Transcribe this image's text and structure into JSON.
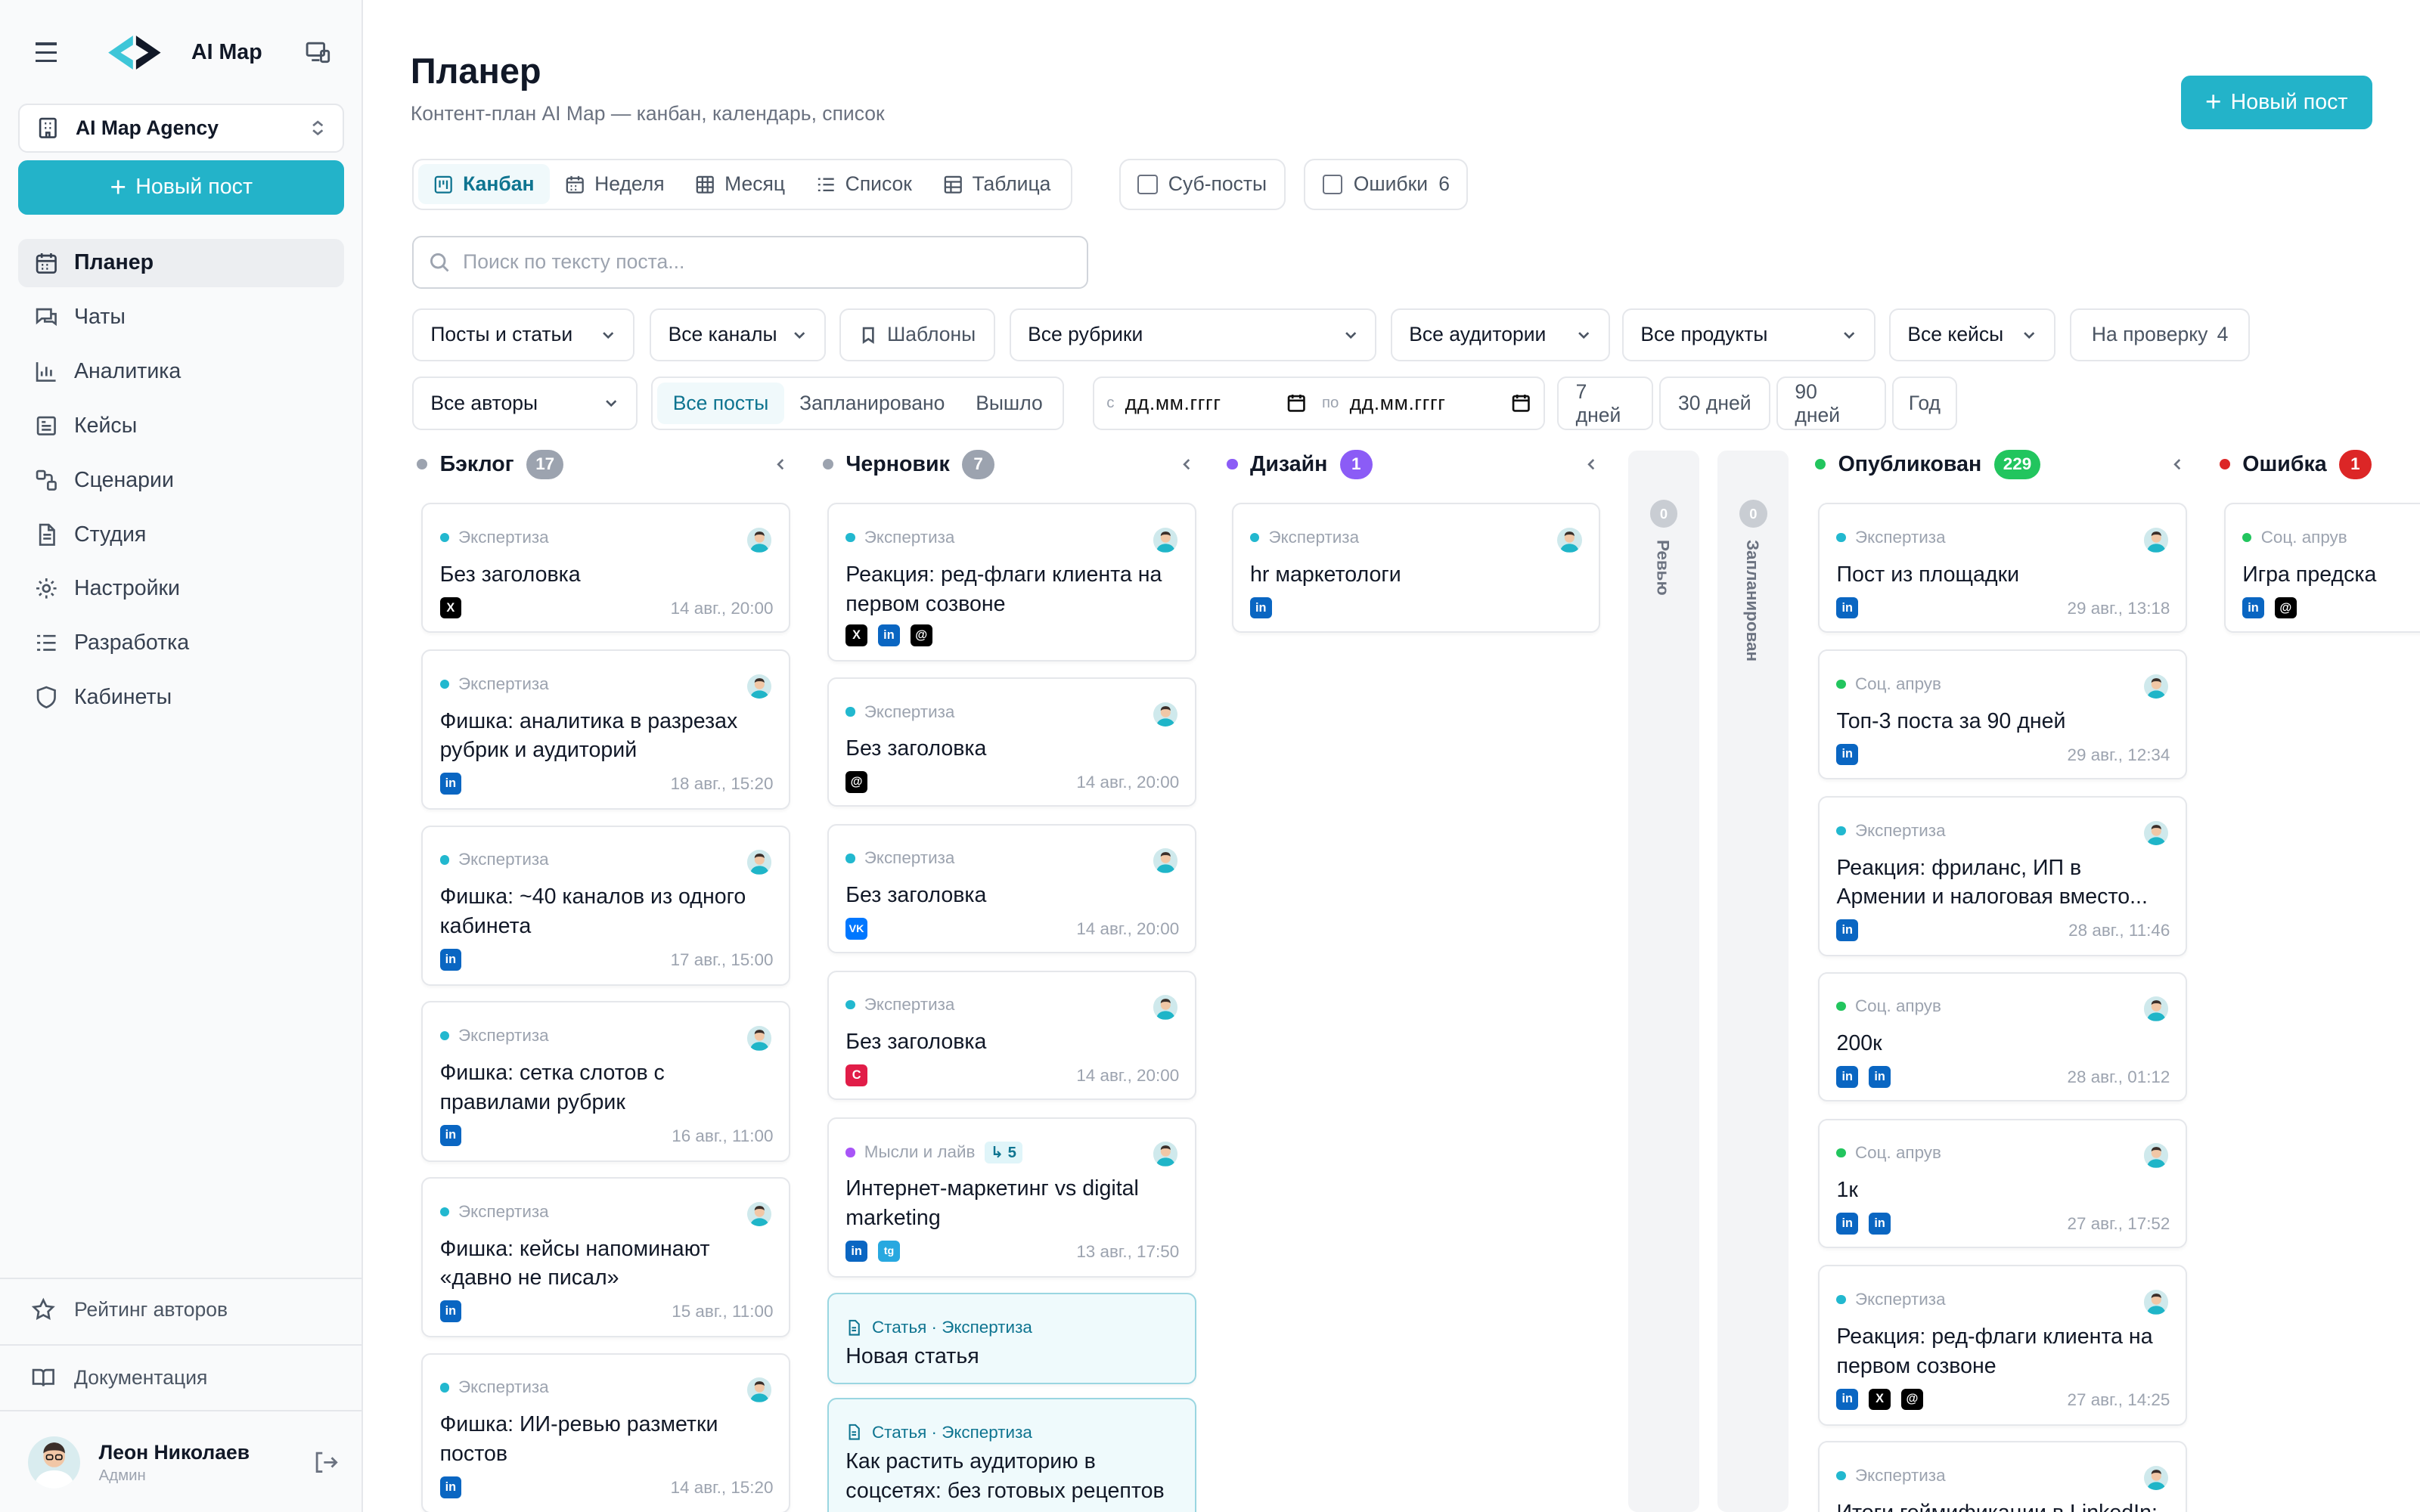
{
  "sidebar": {
    "brand": "AI Map",
    "org": "AI Map Agency",
    "new_post": "Новый пост",
    "nav": [
      {
        "label": "Планер",
        "icon": "calendar-icon",
        "active": true
      },
      {
        "label": "Чаты",
        "icon": "chat-icon"
      },
      {
        "label": "Аналитика",
        "icon": "bar-chart-icon"
      },
      {
        "label": "Кейсы",
        "icon": "cases-icon"
      },
      {
        "label": "Сценарии",
        "icon": "workflow-icon"
      },
      {
        "label": "Студия",
        "icon": "document-icon"
      },
      {
        "label": "Настройки",
        "icon": "gear-icon"
      },
      {
        "label": "Разработка",
        "icon": "list-icon"
      },
      {
        "label": "Кабинеты",
        "icon": "shield-icon"
      }
    ],
    "rating": "Рейтинг авторов",
    "docs": "Документация",
    "user": {
      "name": "Леон Николаев",
      "role": "Админ"
    }
  },
  "header": {
    "title": "Планер",
    "subtitle": "Контент-план AI Map — канбан, календарь, список",
    "new_post": "Новый пост"
  },
  "views": [
    "Канбан",
    "Неделя",
    "Месяц",
    "Список",
    "Таблица"
  ],
  "toggles": {
    "subposts": "Суб-посты",
    "errors": "Ошибки",
    "errors_count": "6"
  },
  "search": {
    "placeholder": "Поиск по тексту поста..."
  },
  "filters": {
    "type": "Посты и статьи",
    "channels": "Все каналы",
    "templates": "Шаблоны",
    "rubrics": "Все рубрики",
    "audiences": "Все аудитории",
    "products": "Все продукты",
    "cases": "Все кейсы",
    "review": "На проверку",
    "review_count": "4",
    "authors": "Все авторы",
    "status_tabs": [
      "Все посты",
      "Запланировано",
      "Вышло"
    ],
    "date_from_label": "с",
    "date_to_label": "по",
    "date_placeholder": "дд.мм.гггг",
    "ranges": [
      "7 дней",
      "30 дней",
      "90 дней",
      "Год"
    ]
  },
  "columns": [
    {
      "name": "Бэклог",
      "count": "17",
      "color": "#9ca3af"
    },
    {
      "name": "Черновик",
      "count": "7",
      "color": "#9ca3af"
    },
    {
      "name": "Дизайн",
      "count": "1",
      "color": "#8b5cf6"
    },
    {
      "name": "Ревью",
      "count": "0"
    },
    {
      "name": "Запланирован",
      "count": "0"
    },
    {
      "name": "Опубликован",
      "count": "229",
      "color": "#22c55e"
    },
    {
      "name": "Ошибка",
      "count": "1",
      "color": "#dc2626"
    }
  ],
  "cards": {
    "backlog": [
      {
        "tag": "Экспертиза",
        "title": "Без заголовка",
        "channels": [
          "x"
        ],
        "time": "14 авг., 20:00"
      },
      {
        "tag": "Экспертиза",
        "title": "Фишка: аналитика в разрезах рубрик и аудиторий",
        "channels": [
          "in"
        ],
        "time": "18 авг., 15:20"
      },
      {
        "tag": "Экспертиза",
        "title": "Фишка: ~40 каналов из одного кабинета",
        "channels": [
          "in"
        ],
        "time": "17 авг., 15:00"
      },
      {
        "tag": "Экспертиза",
        "title": "Фишка: сетка слотов с правилами рубрик",
        "channels": [
          "in"
        ],
        "time": "16 авг., 11:00"
      },
      {
        "tag": "Экспертиза",
        "title": "Фишка: кейсы напоминают «давно не писал»",
        "channels": [
          "in"
        ],
        "time": "15 авг., 11:00"
      },
      {
        "tag": "Экспертиза",
        "title": "Фишка: ИИ-ревью разметки постов",
        "channels": [
          "in"
        ],
        "time": "14 авг., 15:20"
      }
    ],
    "draft": [
      {
        "tag": "Экспертиза",
        "title": "Реакция: ред-флаги клиента на первом созвоне",
        "channels": [
          "x",
          "in",
          "@"
        ],
        "time": ""
      },
      {
        "tag": "Экспертиза",
        "title": "Без заголовка",
        "channels": [
          "@"
        ],
        "time": "14 авг., 20:00"
      },
      {
        "tag": "Экспертиза",
        "title": "Без заголовка",
        "channels": [
          "VK"
        ],
        "time": "14 авг., 20:00"
      },
      {
        "tag": "Экспертиза",
        "title": "Без заголовка",
        "channels": [
          "C"
        ],
        "time": "14 авг., 20:00"
      },
      {
        "tag": "Мысли и лайв",
        "sub": "↳ 5",
        "title": "Интернет-маркетинг vs digital marketing",
        "channels": [
          "in",
          "tg"
        ],
        "time": "13 авг., 17:50"
      },
      {
        "tag": "Статья · Экспертиза",
        "title": "Новая статья"
      },
      {
        "tag": "Статья · Экспертиза",
        "title": "Как растить аудиторию в соцсетях: без готовых рецептов"
      }
    ],
    "design": [
      {
        "tag": "Экспертиза",
        "title": "hr маркетологи",
        "channels": [
          "in"
        ]
      }
    ],
    "published": [
      {
        "tag": "Экспертиза",
        "title": "Пост из площадки",
        "channels": [
          "in"
        ],
        "time": "29 авг., 13:18"
      },
      {
        "tag": "Соц. апрув",
        "title": "Топ-3 поста за 90 дней",
        "channels": [
          "in"
        ],
        "time": "29 авг., 12:34"
      },
      {
        "tag": "Экспертиза",
        "title": "Реакция: фриланс, ИП в Армении и налоговая вместо...",
        "channels": [
          "in"
        ],
        "time": "28 авг., 11:46"
      },
      {
        "tag": "Соц. апрув",
        "title": "200к",
        "channels": [
          "in",
          "in"
        ],
        "time": "28 авг., 01:12"
      },
      {
        "tag": "Соц. апрув",
        "title": "1к",
        "channels": [
          "in",
          "in"
        ],
        "time": "27 авг., 17:52"
      },
      {
        "tag": "Экспертиза",
        "title": "Реакция: ред-флаги клиента на первом созвоне",
        "channels": [
          "in",
          "x",
          "@"
        ],
        "time": "27 авг., 14:25"
      },
      {
        "tag": "Экспертиза",
        "title": "Итоги геймификации в LinkedIn:"
      }
    ],
    "error": [
      {
        "tag": "Соц. апрув",
        "title": "Игра предска",
        "channels": [
          "in",
          "@"
        ]
      }
    ]
  }
}
